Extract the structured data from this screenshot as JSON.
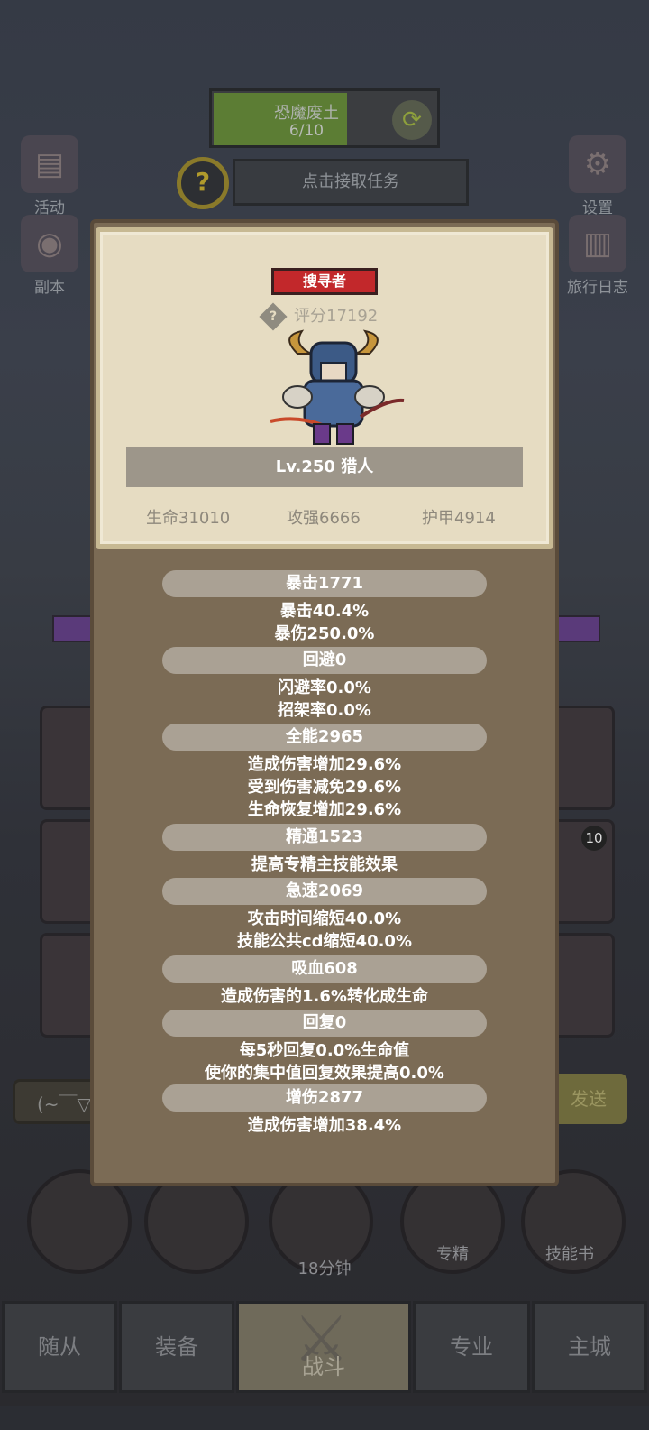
{
  "zone": {
    "name": "恐魔废土",
    "progress_text": "6/10",
    "progress": 0.6
  },
  "quest": {
    "label": "点击接取任务"
  },
  "left_menu": [
    {
      "label": "活动"
    },
    {
      "label": "副本"
    }
  ],
  "right_menu": [
    {
      "label": "设置"
    },
    {
      "label": "旅行日志"
    }
  ],
  "chat": {
    "placeholder": "(~￣▽",
    "send_label": "发送"
  },
  "round_buttons": [
    {
      "label": ""
    },
    {
      "label": ""
    },
    {
      "label": "18分钟"
    },
    {
      "label": "专精"
    },
    {
      "label": "技能书"
    }
  ],
  "tabs": [
    {
      "label": "随从"
    },
    {
      "label": "装备"
    },
    {
      "label": "战斗"
    },
    {
      "label": "专业"
    },
    {
      "label": "主城"
    }
  ],
  "skill_badge": "10",
  "hero": {
    "title": "搜寻者",
    "score": "评分17192",
    "level_name": "Lv.250 猎人",
    "life": "生命31010",
    "attack": "攻强6666",
    "armor": "护甲4914"
  },
  "stats": [
    {
      "header": "暴击1771",
      "lines": [
        "暴击40.4%",
        "暴伤250.0%"
      ]
    },
    {
      "header": "回避0",
      "lines": [
        "闪避率0.0%",
        "招架率0.0%"
      ]
    },
    {
      "header": "全能2965",
      "lines": [
        "造成伤害增加29.6%",
        "受到伤害减免29.6%",
        "生命恢复增加29.6%"
      ]
    },
    {
      "header": "精通1523",
      "lines": [
        "提高专精主技能效果"
      ]
    },
    {
      "header": "急速2069",
      "lines": [
        "攻击时间缩短40.0%",
        "技能公共cd缩短40.0%"
      ]
    },
    {
      "header": "吸血608",
      "lines": [
        "造成伤害的1.6%转化成生命"
      ]
    },
    {
      "header": "回复0",
      "lines": [
        "每5秒回复0.0%生命值",
        "使你的集中值回复效果提高0.0%"
      ]
    },
    {
      "header": "增伤2877",
      "lines": [
        "造成伤害增加38.4%"
      ]
    }
  ]
}
